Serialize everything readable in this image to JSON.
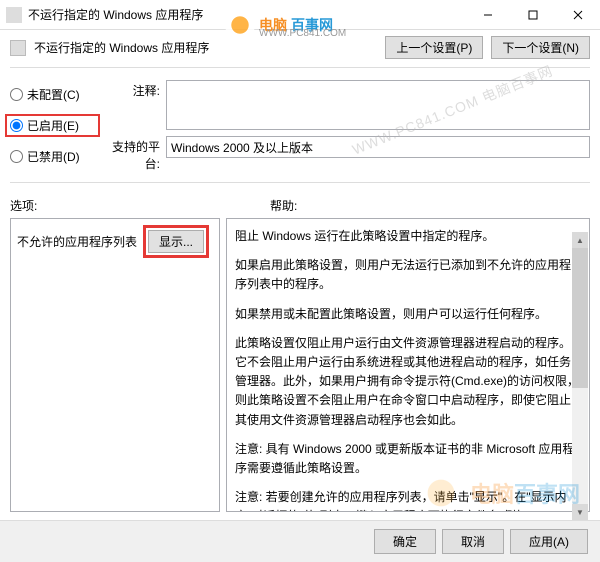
{
  "titlebar": {
    "title": "不运行指定的 Windows 应用程序"
  },
  "header": {
    "title": "不运行指定的 Windows 应用程序",
    "prev_btn": "上一个设置(P)",
    "next_btn": "下一个设置(N)"
  },
  "radios": {
    "not_configured": "未配置(C)",
    "enabled": "已启用(E)",
    "disabled": "已禁用(D)"
  },
  "fields": {
    "comment_label": "注释:",
    "comment_value": "",
    "platform_label": "支持的平台:",
    "platform_value": "Windows 2000 及以上版本"
  },
  "sections": {
    "options": "选项:",
    "help": "帮助:"
  },
  "left": {
    "list_label": "不允许的应用程序列表",
    "show_btn": "显示..."
  },
  "help_text": {
    "p1": "阻止 Windows 运行在此策略设置中指定的程序。",
    "p2": "如果启用此策略设置，则用户无法运行已添加到不允许的应用程序列表中的程序。",
    "p3": "如果禁用或未配置此策略设置，则用户可以运行任何程序。",
    "p4": "此策略设置仅阻止用户运行由文件资源管理器进程启动的程序。它不会阻止用户运行由系统进程或其他进程启动的程序，如任务管理器。此外，如果用户拥有命令提示符(Cmd.exe)的访问权限，则此策略设置不会阻止用户在命令窗口中启动程序，即使它阻止其使用文件资源管理器启动程序也会如此。",
    "p5": "注意: 具有 Windows 2000 或更新版本证书的非 Microsoft 应用程序需要遵循此策略设置。",
    "p6": "注意: 若要创建允许的应用程序列表，请单击\"显示\"。在\"显示内容\"对话框的\"值\"列中，键入应用程序可执行文件名(例如，Winword.exe、Poledit.exe 和 Powerpnt.exe)。"
  },
  "footer": {
    "ok": "确定",
    "cancel": "取消",
    "apply": "应用(A)"
  },
  "watermark": {
    "brand_cn": "电脑",
    "brand_cn2": "百事网",
    "url": "WWW.PC841.COM",
    "diag": "WWW.PC841.COM 电脑百事网"
  }
}
